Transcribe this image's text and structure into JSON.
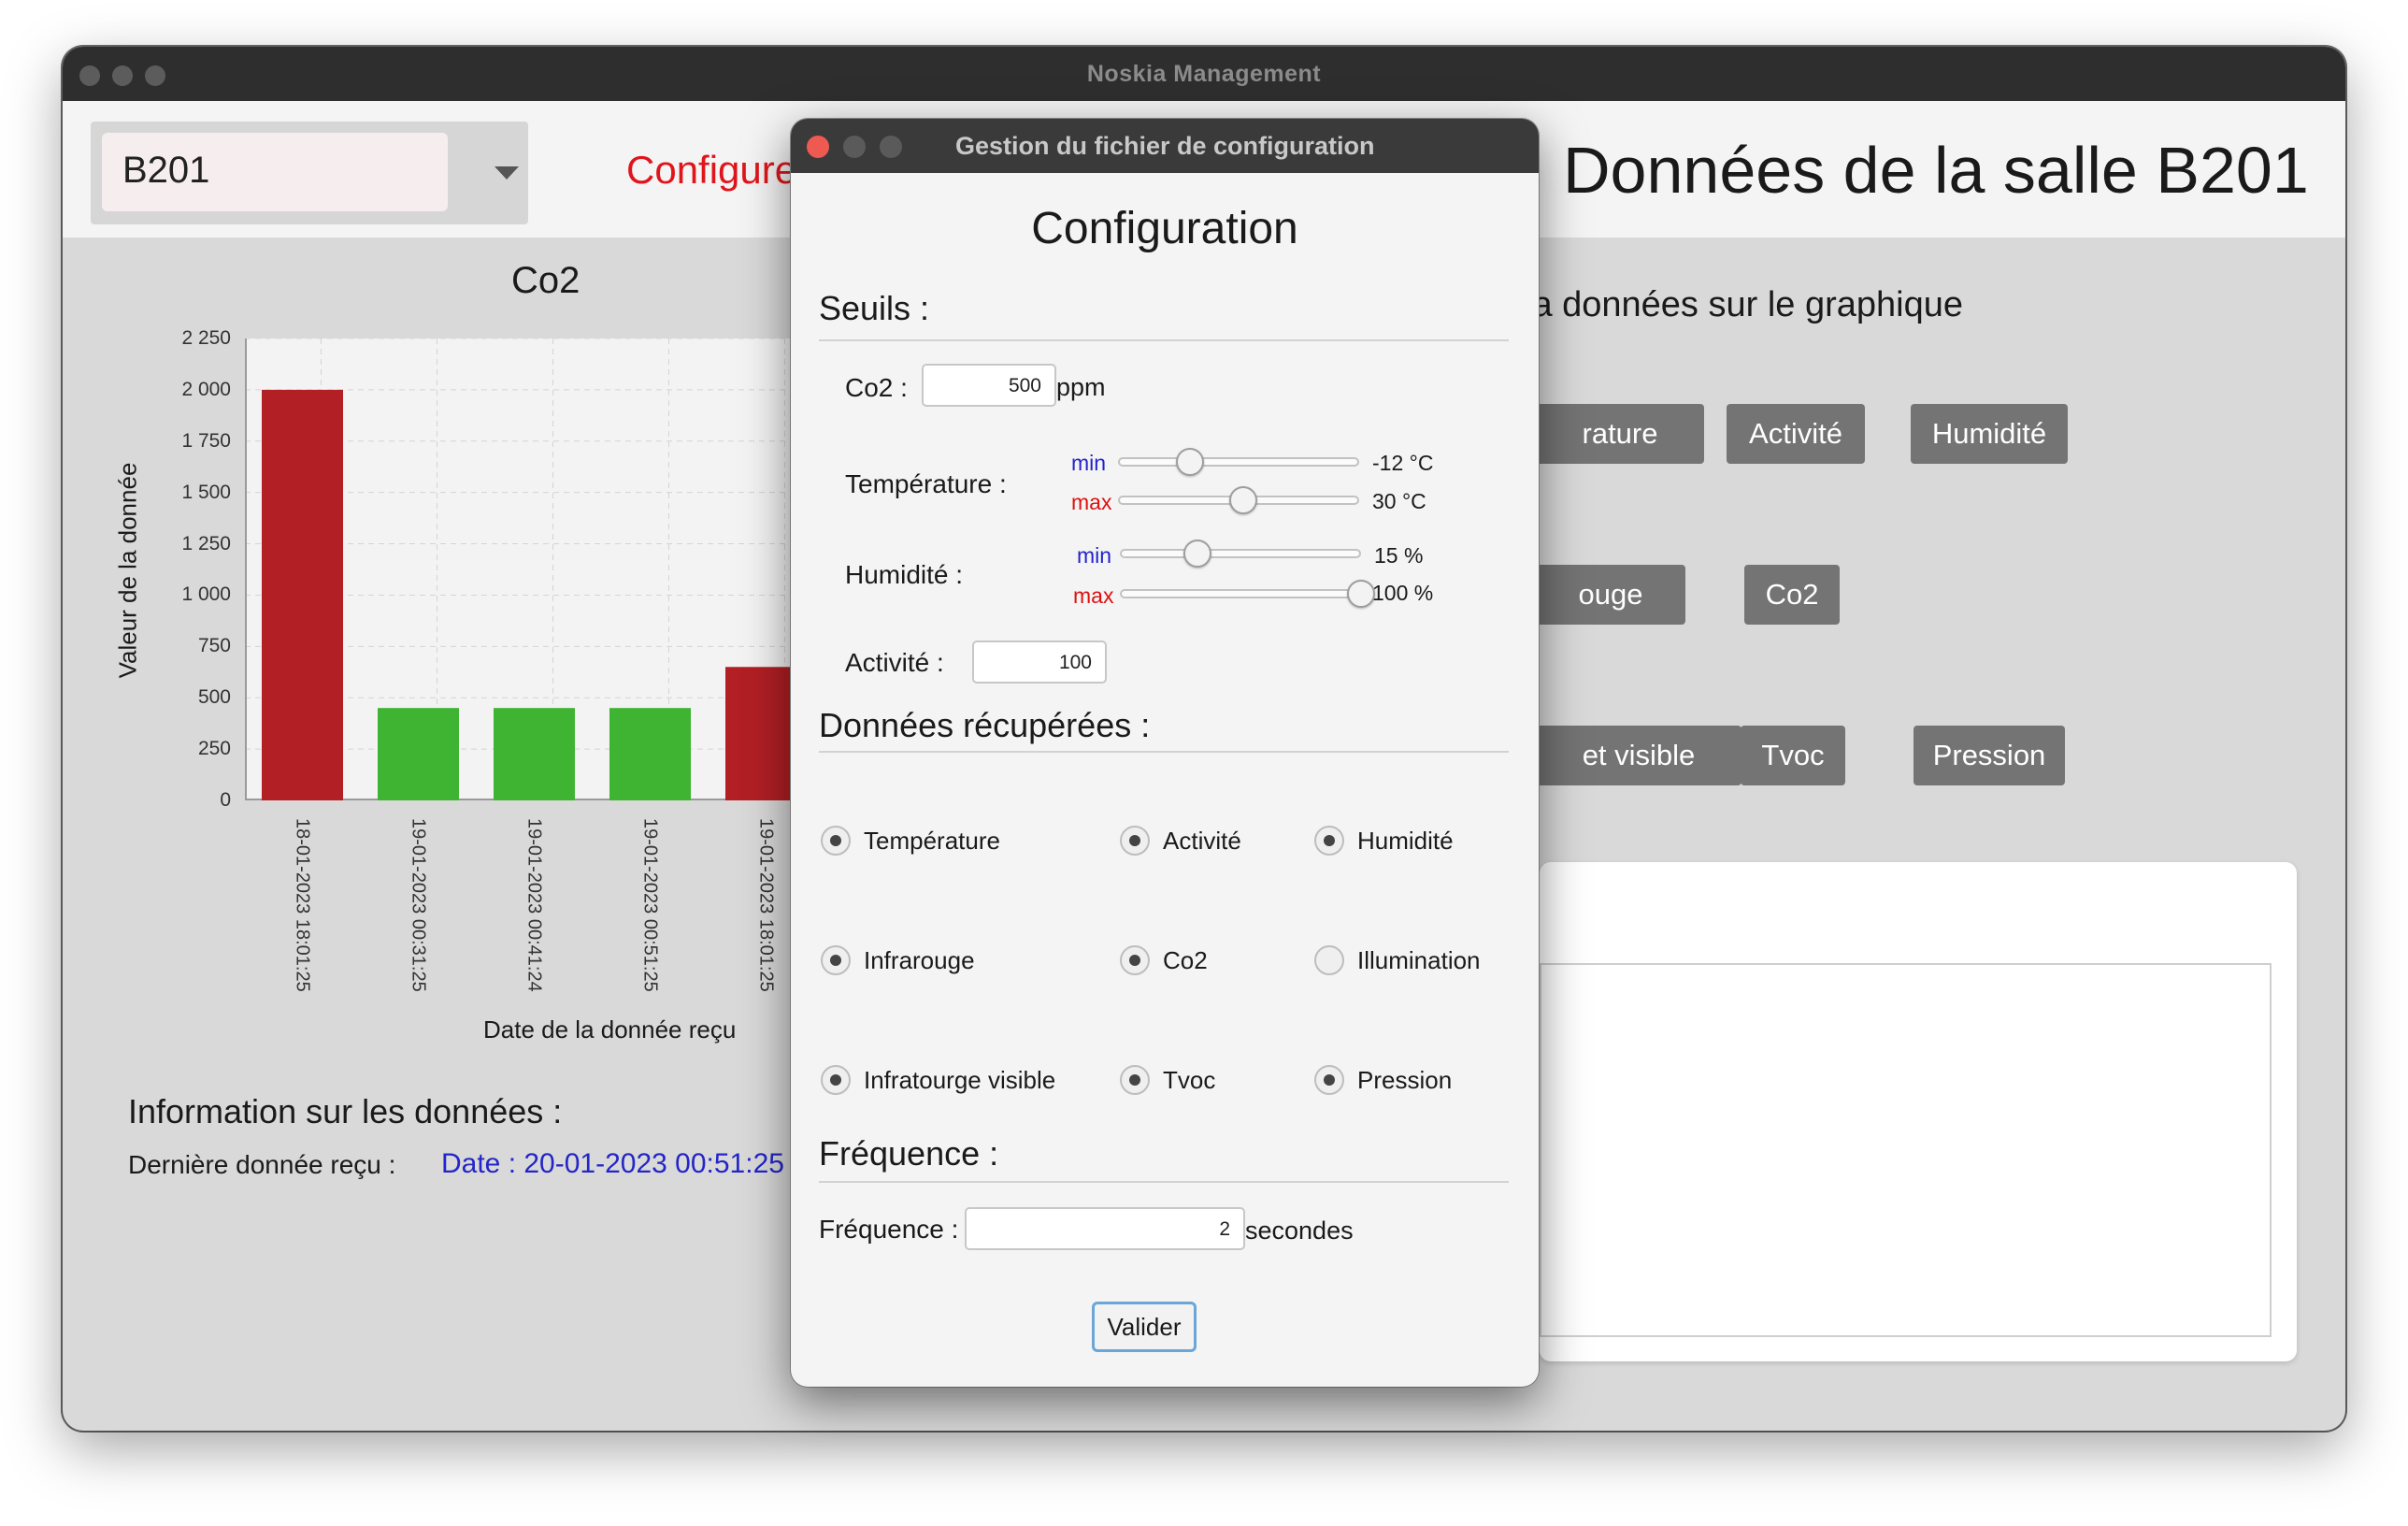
{
  "main_window": {
    "title": "Noskia Management",
    "room_selector": {
      "value": "B201"
    },
    "configure_link": "Configure",
    "room_title": "Données de la salle B201",
    "graph_hint": "la données sur le graphique",
    "buttons": {
      "temperature": "rature",
      "activite": "Activité",
      "humidite": "Humidité",
      "infrarouge": "ouge",
      "co2": "Co2",
      "infrarouge_visible": "et visible",
      "tvoc": "Tvoc",
      "pression": "Pression"
    },
    "info": {
      "title": "Information sur les données :",
      "last_label": "Dernière donnée reçu :",
      "last_value": "Date : 20-01-2023 00:51:25 /"
    }
  },
  "chart_data": {
    "type": "bar",
    "title": "Co2",
    "xlabel": "Date de la donnée reçu",
    "ylabel": "Valeur de la donnée",
    "ylim": [
      0,
      2250
    ],
    "yticks": [
      "0",
      "250",
      "500",
      "750",
      "1 000",
      "1 250",
      "1 500",
      "1 750",
      "2 000",
      "2 250"
    ],
    "categories": [
      "18-01-2023 18:01:25",
      "19-01-2023 00:31:25",
      "19-01-2023 00:41:24",
      "19-01-2023 00:51:25",
      "19-01-2023 18:01:25"
    ],
    "values": [
      2000,
      450,
      450,
      450,
      650
    ],
    "colors": [
      "#b21f24",
      "#3fb332",
      "#3fb332",
      "#3fb332",
      "#b21f24"
    ],
    "grid": true
  },
  "dialog": {
    "title": "Gestion du fichier de configuration",
    "heading": "Configuration",
    "seuils": {
      "title": "Seuils :",
      "co2_label": "Co2 :",
      "co2_value": "500",
      "co2_unit": "ppm",
      "temperature_label": "Température :",
      "min_label": "min",
      "max_label": "max",
      "temp_min": "-12 °C",
      "temp_max": "30 °C",
      "temp_min_level": 0.3,
      "temp_max_level": 0.52,
      "humidite_label": "Humidité :",
      "hum_min": "15 %",
      "hum_max": "100 %",
      "hum_min_level": 0.32,
      "hum_max_level": 1.0,
      "activite_label": "Activité :",
      "activite_value": "100"
    },
    "donnees": {
      "title": "Données récupérées :",
      "options": [
        {
          "label": "Température",
          "checked": true
        },
        {
          "label": "Activité",
          "checked": true
        },
        {
          "label": "Humidité",
          "checked": true
        },
        {
          "label": "Infrarouge",
          "checked": true
        },
        {
          "label": "Co2",
          "checked": true
        },
        {
          "label": "Illumination",
          "checked": false
        },
        {
          "label": "Infratourge visible",
          "checked": true
        },
        {
          "label": "Tvoc",
          "checked": true
        },
        {
          "label": "Pression",
          "checked": true
        }
      ]
    },
    "frequence": {
      "title": "Fréquence :",
      "label": "Fréquence :",
      "value": "2",
      "unit": "secondes"
    },
    "valider": "Valider",
    "colors": {
      "min": "#2222cc",
      "max": "#dd1111"
    }
  }
}
